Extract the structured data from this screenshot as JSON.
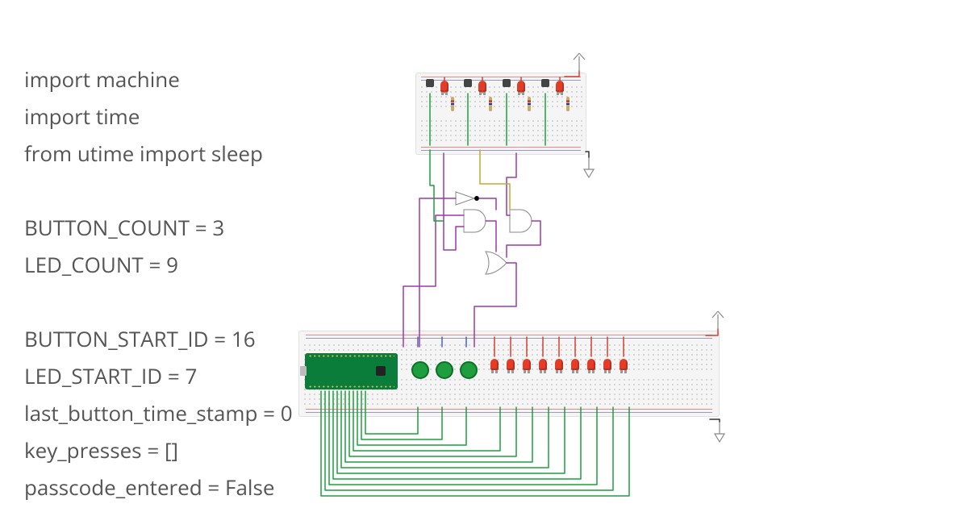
{
  "code_lines": [
    "import machine",
    "import time",
    "from utime import sleep",
    "",
    "BUTTON_COUNT = 3",
    "LED_COUNT = 9",
    "",
    "BUTTON_START_ID = 16",
    "LED_START_ID = 7",
    "last_button_time_stamp = 0",
    "key_presses = []",
    "passcode_entered = False"
  ],
  "components": {
    "microcontroller": "raspberry-pi-pico",
    "small_breadboard": {
      "buttons": 4,
      "leds": 4,
      "led_color": "red"
    },
    "large_breadboard": {
      "green_buttons": 3,
      "leds": 9,
      "led_color": "red"
    },
    "logic_gates": [
      "NOT",
      "AND",
      "AND",
      "OR"
    ]
  },
  "wire_colors": [
    "green",
    "purple",
    "red",
    "blue",
    "yellow",
    "black"
  ]
}
